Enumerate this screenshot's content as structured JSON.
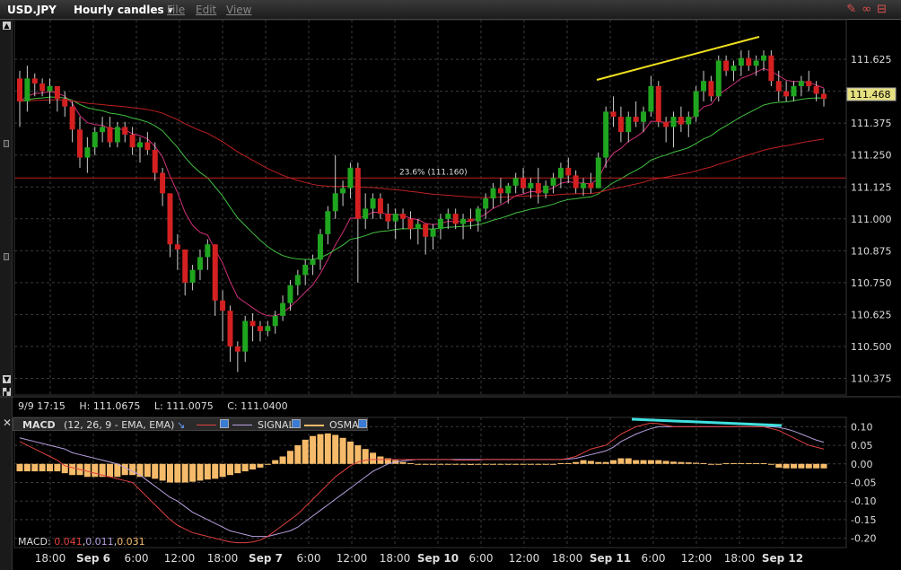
{
  "header": {
    "symbol": "USD.JPY",
    "period": "Hourly candles",
    "menus": [
      "File",
      "Edit",
      "View"
    ]
  },
  "colors": {
    "up": "#1fa51f",
    "down": "#d42020",
    "ema_fast": "#d0307a",
    "ema_mid": "#40c040",
    "ema_slow": "#c02020",
    "trend": "#f0e020",
    "macd_trend": "#40e0e0",
    "osma": "#f5bb6a",
    "signal": "#b8a0e0",
    "macd": "#e04040",
    "last_price_bg": "#e6e080"
  },
  "info": {
    "date": "9/9 17:15",
    "high": "H: 111.0675",
    "low": "L: 111.0075",
    "close": "C: 111.0400"
  },
  "last_price": "111.468",
  "fib_label": "23.6% (111.160)",
  "macd_header": {
    "name": "MACD",
    "params": "(12, 26, 9 - EMA, EMA)",
    "signal_label": "SIGNAL",
    "osma_label": "OSMA"
  },
  "macd_info": {
    "prefix": "MACD:",
    "v1": "0.041",
    "sep1": ",",
    "v2": "0.011",
    "sep2": ",",
    "v3": "0.031"
  },
  "chart_data": {
    "type": "candlestick",
    "price_ticks": [
      "111.625",
      "111.500",
      "111.375",
      "111.250",
      "111.125",
      "111.000",
      "110.875",
      "110.750",
      "110.625",
      "110.500",
      "110.375"
    ],
    "price_tick_values": [
      111.625,
      111.5,
      111.375,
      111.25,
      111.125,
      111.0,
      110.875,
      110.75,
      110.625,
      110.5,
      110.375
    ],
    "macd_ticks": [
      "0.10",
      "0.05",
      "0.00",
      "-0.05",
      "-0.10",
      "-0.15",
      "-0.20"
    ],
    "macd_tick_values": [
      0.1,
      0.05,
      0.0,
      -0.05,
      -0.1,
      -0.15,
      -0.2
    ],
    "time_labels": [
      {
        "label": "18:00",
        "x": 42
      },
      {
        "label": "Sep 6",
        "x": 90
      },
      {
        "label": "6:00",
        "x": 138
      },
      {
        "label": "12:00",
        "x": 186
      },
      {
        "label": "18:00",
        "x": 234
      },
      {
        "label": "Sep 7",
        "x": 282
      },
      {
        "label": "6:00",
        "x": 330
      },
      {
        "label": "12:00",
        "x": 378
      },
      {
        "label": "18:00",
        "x": 426
      },
      {
        "label": "Sep 10",
        "x": 474
      },
      {
        "label": "6:00",
        "x": 522
      },
      {
        "label": "12:00",
        "x": 570
      },
      {
        "label": "18:00",
        "x": 618
      },
      {
        "label": "Sep 11",
        "x": 666
      },
      {
        "label": "6:00",
        "x": 714
      },
      {
        "label": "12:00",
        "x": 762
      },
      {
        "label": "18:00",
        "x": 810
      },
      {
        "label": "Sep 12",
        "x": 858
      }
    ],
    "candles": [
      [
        111.55,
        111.58,
        111.36,
        111.46
      ],
      [
        111.46,
        111.6,
        111.42,
        111.55
      ],
      [
        111.55,
        111.57,
        111.48,
        111.53
      ],
      [
        111.53,
        111.55,
        111.48,
        111.5
      ],
      [
        111.5,
        111.55,
        111.45,
        111.52
      ],
      [
        111.52,
        111.52,
        111.42,
        111.47
      ],
      [
        111.47,
        111.5,
        111.4,
        111.44
      ],
      [
        111.44,
        111.46,
        111.3,
        111.35
      ],
      [
        111.35,
        111.4,
        111.2,
        111.24
      ],
      [
        111.24,
        111.32,
        111.18,
        111.28
      ],
      [
        111.28,
        111.36,
        111.25,
        111.34
      ],
      [
        111.34,
        111.4,
        111.3,
        111.36
      ],
      [
        111.36,
        111.4,
        111.28,
        111.3
      ],
      [
        111.3,
        111.38,
        111.28,
        111.36
      ],
      [
        111.36,
        111.38,
        111.3,
        111.33
      ],
      [
        111.33,
        111.36,
        111.25,
        111.28
      ],
      [
        111.28,
        111.32,
        111.22,
        111.3
      ],
      [
        111.3,
        111.34,
        111.25,
        111.27
      ],
      [
        111.27,
        111.3,
        111.15,
        111.18
      ],
      [
        111.18,
        111.2,
        111.05,
        111.1
      ],
      [
        111.1,
        111.1,
        110.85,
        110.9
      ],
      [
        110.9,
        110.94,
        110.8,
        110.88
      ],
      [
        110.88,
        110.88,
        110.7,
        110.75
      ],
      [
        110.75,
        110.82,
        110.72,
        110.8
      ],
      [
        110.8,
        110.88,
        110.76,
        110.85
      ],
      [
        110.85,
        110.92,
        110.8,
        110.9
      ],
      [
        110.9,
        110.9,
        110.62,
        110.68
      ],
      [
        110.68,
        110.72,
        110.52,
        110.64
      ],
      [
        110.64,
        110.66,
        110.44,
        110.5
      ],
      [
        110.5,
        110.52,
        110.4,
        110.48
      ],
      [
        110.48,
        110.62,
        110.44,
        110.6
      ],
      [
        110.6,
        110.63,
        110.52,
        110.58
      ],
      [
        110.58,
        110.6,
        110.52,
        110.56
      ],
      [
        110.56,
        110.6,
        110.54,
        110.58
      ],
      [
        110.58,
        110.64,
        110.55,
        110.62
      ],
      [
        110.62,
        110.7,
        110.6,
        110.67
      ],
      [
        110.67,
        110.76,
        110.64,
        110.74
      ],
      [
        110.74,
        110.8,
        110.7,
        110.78
      ],
      [
        110.78,
        110.84,
        110.74,
        110.82
      ],
      [
        110.82,
        110.86,
        110.78,
        110.84
      ],
      [
        110.84,
        110.96,
        110.8,
        110.94
      ],
      [
        110.94,
        111.05,
        110.9,
        111.03
      ],
      [
        111.03,
        111.25,
        111.0,
        111.1
      ],
      [
        111.1,
        111.15,
        111.05,
        111.12
      ],
      [
        111.12,
        111.22,
        111.08,
        111.2
      ],
      [
        111.2,
        111.22,
        110.75,
        111.0
      ],
      [
        111.0,
        111.1,
        110.96,
        111.04
      ],
      [
        111.04,
        111.1,
        111.0,
        111.08
      ],
      [
        111.08,
        111.1,
        111.0,
        111.02
      ],
      [
        111.02,
        111.06,
        110.96,
        110.99
      ],
      [
        110.99,
        111.04,
        110.92,
        111.02
      ],
      [
        111.02,
        111.04,
        110.96,
        111.0
      ],
      [
        111.0,
        111.03,
        110.92,
        110.96
      ],
      [
        110.96,
        111.0,
        110.9,
        110.98
      ],
      [
        110.98,
        110.98,
        110.86,
        110.93
      ],
      [
        110.93,
        110.98,
        110.88,
        110.96
      ],
      [
        110.96,
        111.02,
        110.92,
        111.0
      ],
      [
        111.0,
        111.04,
        110.96,
        111.02
      ],
      [
        111.02,
        111.04,
        110.96,
        110.98
      ],
      [
        110.98,
        111.02,
        110.92,
        111.0
      ],
      [
        111.0,
        111.04,
        110.96,
        110.99
      ],
      [
        110.99,
        111.05,
        110.95,
        111.04
      ],
      [
        111.04,
        111.1,
        111.0,
        111.08
      ],
      [
        111.08,
        111.14,
        111.04,
        111.12
      ],
      [
        111.12,
        111.16,
        111.06,
        111.1
      ],
      [
        111.1,
        111.14,
        111.06,
        111.13
      ],
      [
        111.13,
        111.18,
        111.1,
        111.16
      ],
      [
        111.16,
        111.2,
        111.1,
        111.12
      ],
      [
        111.12,
        111.16,
        111.08,
        111.14
      ],
      [
        111.14,
        111.2,
        111.06,
        111.1
      ],
      [
        111.1,
        111.15,
        111.08,
        111.13
      ],
      [
        111.13,
        111.18,
        111.1,
        111.16
      ],
      [
        111.16,
        111.22,
        111.12,
        111.2
      ],
      [
        111.2,
        111.24,
        111.14,
        111.17
      ],
      [
        111.17,
        111.19,
        111.1,
        111.12
      ],
      [
        111.12,
        111.16,
        111.09,
        111.14
      ],
      [
        111.14,
        111.18,
        111.1,
        111.12
      ],
      [
        111.12,
        111.26,
        111.12,
        111.24
      ],
      [
        111.24,
        111.44,
        111.2,
        111.42
      ],
      [
        111.42,
        111.48,
        111.36,
        111.4
      ],
      [
        111.4,
        111.44,
        111.3,
        111.34
      ],
      [
        111.34,
        111.42,
        111.3,
        111.4
      ],
      [
        111.4,
        111.46,
        111.36,
        111.38
      ],
      [
        111.38,
        111.44,
        111.34,
        111.42
      ],
      [
        111.42,
        111.56,
        111.4,
        111.52
      ],
      [
        111.52,
        111.54,
        111.36,
        111.38
      ],
      [
        111.38,
        111.4,
        111.3,
        111.36
      ],
      [
        111.36,
        111.42,
        111.28,
        111.4
      ],
      [
        111.4,
        111.44,
        111.34,
        111.37
      ],
      [
        111.37,
        111.42,
        111.32,
        111.4
      ],
      [
        111.4,
        111.52,
        111.38,
        111.5
      ],
      [
        111.5,
        111.58,
        111.46,
        111.54
      ],
      [
        111.54,
        111.56,
        111.46,
        111.48
      ],
      [
        111.48,
        111.64,
        111.46,
        111.62
      ],
      [
        111.62,
        111.64,
        111.56,
        111.58
      ],
      [
        111.58,
        111.62,
        111.54,
        111.6
      ],
      [
        111.6,
        111.66,
        111.56,
        111.63
      ],
      [
        111.63,
        111.66,
        111.58,
        111.6
      ],
      [
        111.6,
        111.64,
        111.56,
        111.62
      ],
      [
        111.62,
        111.66,
        111.58,
        111.64
      ],
      [
        111.64,
        111.66,
        111.52,
        111.54
      ],
      [
        111.54,
        111.58,
        111.46,
        111.5
      ],
      [
        111.5,
        111.54,
        111.46,
        111.48
      ],
      [
        111.48,
        111.54,
        111.46,
        111.52
      ],
      [
        111.52,
        111.56,
        111.48,
        111.54
      ],
      [
        111.54,
        111.58,
        111.5,
        111.52
      ],
      [
        111.52,
        111.54,
        111.46,
        111.49
      ],
      [
        111.49,
        111.51,
        111.44,
        111.47
      ]
    ],
    "osma": [
      -0.02,
      -0.02,
      -0.02,
      -0.02,
      -0.02,
      -0.02,
      -0.025,
      -0.03,
      -0.03,
      -0.035,
      -0.035,
      -0.035,
      -0.035,
      -0.035,
      -0.03,
      -0.03,
      -0.035,
      -0.035,
      -0.04,
      -0.045,
      -0.05,
      -0.05,
      -0.05,
      -0.048,
      -0.045,
      -0.042,
      -0.04,
      -0.035,
      -0.03,
      -0.025,
      -0.02,
      -0.015,
      -0.01,
      0.0,
      0.01,
      0.02,
      0.035,
      0.05,
      0.065,
      0.075,
      0.08,
      0.082,
      0.078,
      0.07,
      0.06,
      0.05,
      0.04,
      0.03,
      0.02,
      0.015,
      0.01,
      0.005,
      0.002,
      0.0,
      0.0,
      0.0,
      0.0,
      0.0,
      -0.002,
      -0.002,
      -0.003,
      0.0,
      0.0,
      0.0,
      0.0,
      0.0,
      0.0,
      0.0,
      0.0,
      0.0,
      0.0,
      0.0,
      0.002,
      0.002,
      0.005,
      0.01,
      0.008,
      0.005,
      0.005,
      0.01,
      0.015,
      0.015,
      0.01,
      0.01,
      0.01,
      0.01,
      0.008,
      0.006,
      0.005,
      0.004,
      0.003,
      0.002,
      -0.002,
      0.0,
      0.002,
      0.002,
      0.002,
      0.002,
      0.002,
      0.002,
      0.0,
      -0.01,
      -0.012,
      -0.012,
      -0.012,
      -0.012,
      -0.012,
      -0.012
    ],
    "macd": [
      0.06,
      0.05,
      0.04,
      0.03,
      0.02,
      0.01,
      -0.005,
      -0.01,
      -0.015,
      -0.02,
      -0.025,
      -0.03,
      -0.035,
      -0.04,
      -0.045,
      -0.05,
      -0.07,
      -0.09,
      -0.11,
      -0.13,
      -0.15,
      -0.165,
      -0.175,
      -0.185,
      -0.19,
      -0.195,
      -0.2,
      -0.205,
      -0.21,
      -0.212,
      -0.212,
      -0.21,
      -0.205,
      -0.195,
      -0.18,
      -0.165,
      -0.15,
      -0.135,
      -0.115,
      -0.095,
      -0.075,
      -0.055,
      -0.035,
      -0.02,
      -0.005,
      0.005,
      0.01,
      0.012,
      0.012,
      0.012,
      0.012,
      0.012,
      0.012,
      0.012,
      0.012,
      0.012,
      0.012,
      0.012,
      0.01,
      0.01,
      0.01,
      0.01,
      0.012,
      0.012,
      0.012,
      0.012,
      0.012,
      0.012,
      0.012,
      0.012,
      0.012,
      0.012,
      0.012,
      0.015,
      0.02,
      0.03,
      0.04,
      0.045,
      0.05,
      0.065,
      0.08,
      0.09,
      0.1,
      0.105,
      0.11,
      0.108,
      0.104,
      0.1,
      0.1,
      0.1,
      0.1,
      0.1,
      0.1,
      0.1,
      0.1,
      0.1,
      0.1,
      0.1,
      0.1,
      0.1,
      0.095,
      0.09,
      0.08,
      0.07,
      0.06,
      0.05,
      0.045,
      0.04
    ],
    "signal": [
      0.07,
      0.065,
      0.06,
      0.055,
      0.05,
      0.045,
      0.04,
      0.03,
      0.025,
      0.02,
      0.015,
      0.01,
      0.005,
      0.0,
      -0.01,
      -0.02,
      -0.03,
      -0.045,
      -0.06,
      -0.075,
      -0.09,
      -0.1,
      -0.115,
      -0.13,
      -0.14,
      -0.15,
      -0.16,
      -0.17,
      -0.18,
      -0.185,
      -0.19,
      -0.195,
      -0.195,
      -0.195,
      -0.19,
      -0.185,
      -0.18,
      -0.17,
      -0.155,
      -0.14,
      -0.125,
      -0.11,
      -0.095,
      -0.08,
      -0.065,
      -0.05,
      -0.035,
      -0.02,
      -0.01,
      0.0,
      0.005,
      0.008,
      0.01,
      0.012,
      0.012,
      0.012,
      0.012,
      0.012,
      0.012,
      0.012,
      0.012,
      0.012,
      0.012,
      0.012,
      0.012,
      0.012,
      0.012,
      0.012,
      0.012,
      0.012,
      0.012,
      0.012,
      0.012,
      0.013,
      0.015,
      0.02,
      0.025,
      0.03,
      0.035,
      0.045,
      0.06,
      0.07,
      0.08,
      0.088,
      0.095,
      0.1,
      0.1,
      0.1,
      0.1,
      0.1,
      0.1,
      0.1,
      0.1,
      0.1,
      0.1,
      0.1,
      0.1,
      0.1,
      0.1,
      0.1,
      0.1,
      0.098,
      0.094,
      0.088,
      0.08,
      0.072,
      0.064,
      0.058
    ],
    "fib_level": 111.16,
    "ylim": [
      110.31,
      111.78
    ],
    "macd_ylim": [
      -0.225,
      0.125
    ]
  }
}
